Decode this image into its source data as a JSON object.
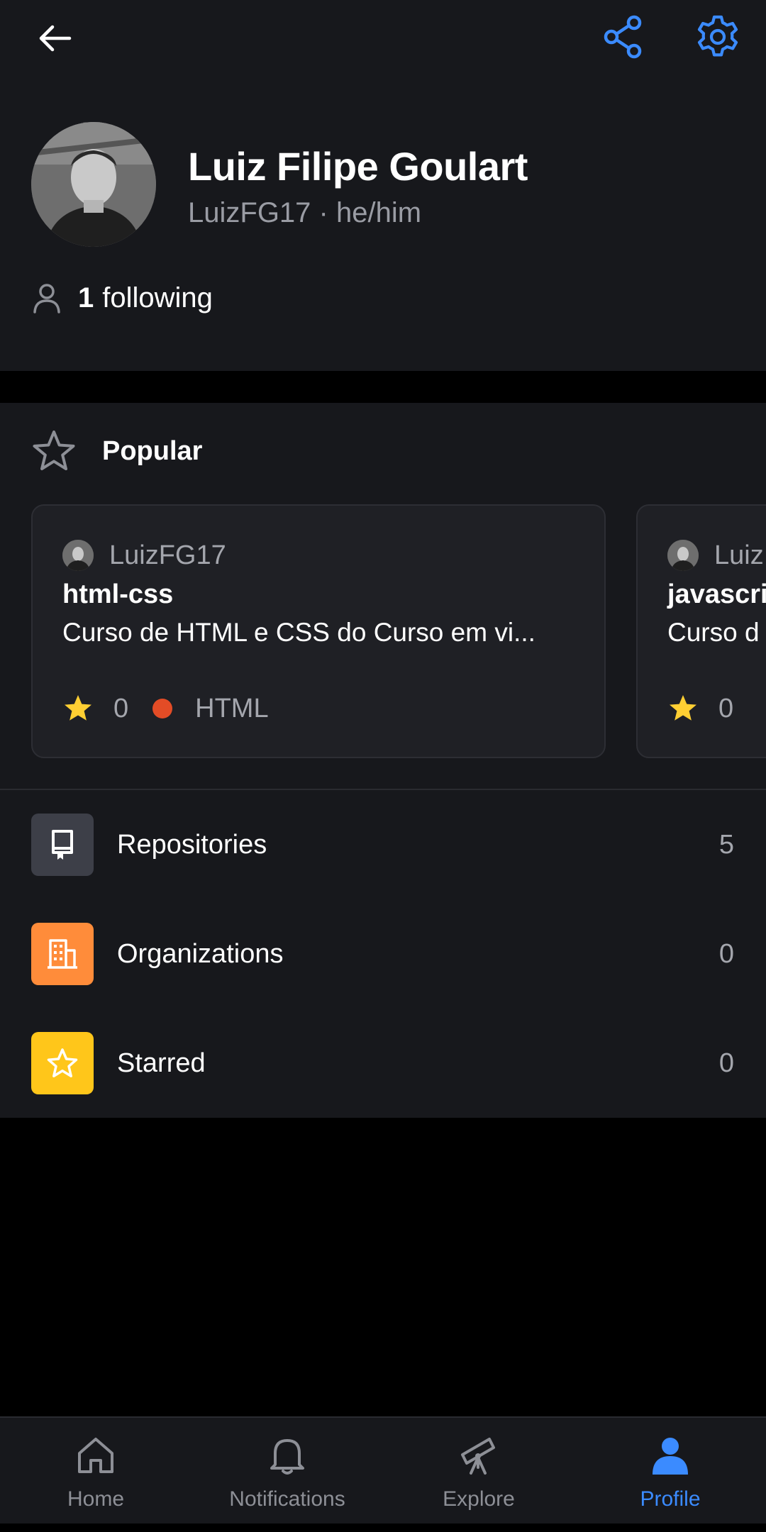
{
  "topbar": {
    "back_icon": "arrow-left-icon",
    "share_icon": "share-icon",
    "settings_icon": "gear-icon",
    "accent_color": "#3b8bff"
  },
  "profile": {
    "name": "Luiz Filipe Goulart",
    "login_pronouns": "LuizFG17 · he/him",
    "following_count": "1",
    "following_label": "following"
  },
  "popular": {
    "title": "Popular",
    "cards": [
      {
        "owner": "LuizFG17",
        "repo": "html-css",
        "description": "Curso de HTML e CSS do Curso em vi...",
        "stars": "0",
        "language": "HTML",
        "language_color": "#e34c26"
      },
      {
        "owner": "Luiz",
        "repo": "javascri",
        "description": "Curso d",
        "stars": "0"
      }
    ]
  },
  "list": [
    {
      "label": "Repositories",
      "count": "5",
      "icon": "repo-icon",
      "color": "#3d3f48"
    },
    {
      "label": "Organizations",
      "count": "0",
      "icon": "organization-icon",
      "color": "#ff8c3a"
    },
    {
      "label": "Starred",
      "count": "0",
      "icon": "star-icon",
      "color": "#ffc61a"
    }
  ],
  "nav": [
    {
      "label": "Home",
      "icon": "home-icon",
      "active": false
    },
    {
      "label": "Notifications",
      "icon": "bell-icon",
      "active": false
    },
    {
      "label": "Explore",
      "icon": "telescope-icon",
      "active": false
    },
    {
      "label": "Profile",
      "icon": "person-icon",
      "active": true
    }
  ]
}
